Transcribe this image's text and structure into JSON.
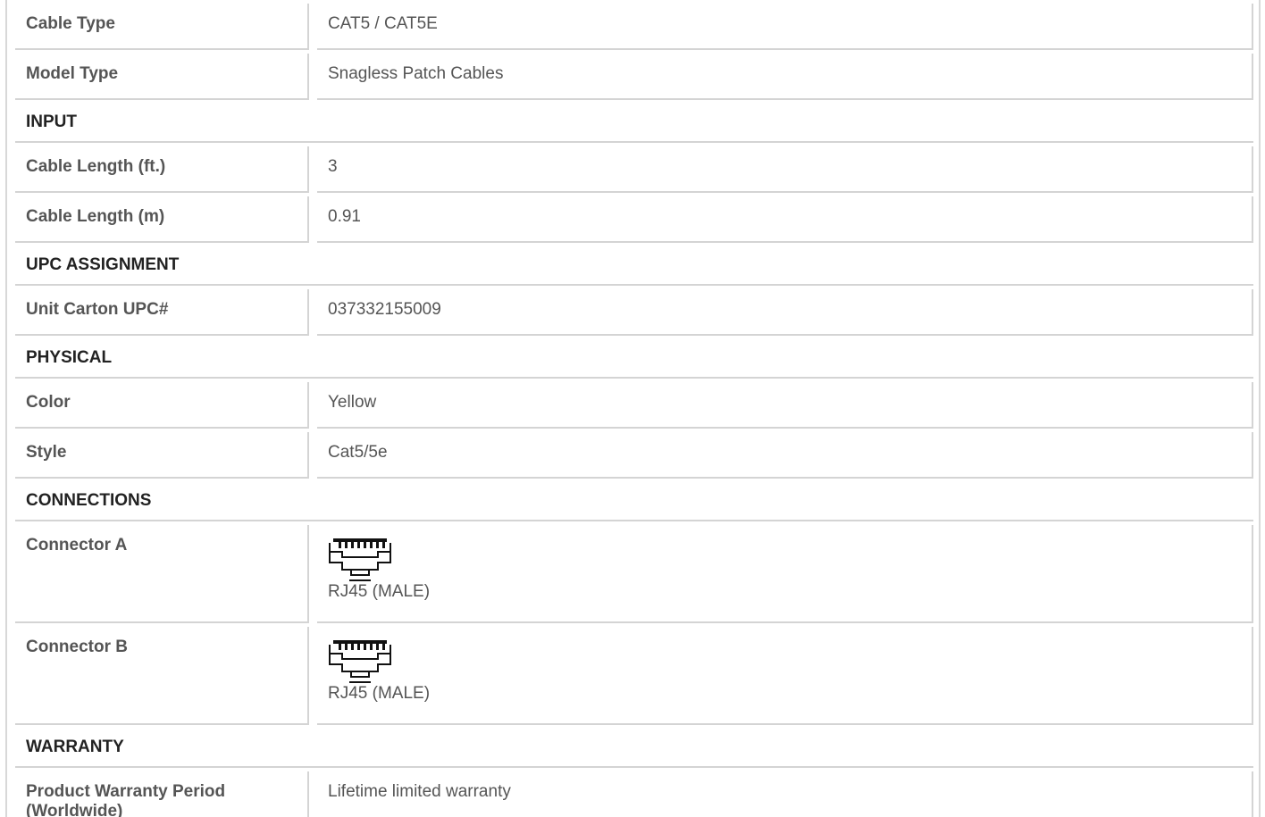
{
  "rows": {
    "cable_type": {
      "label": "Cable Type",
      "value": "CAT5 / CAT5E"
    },
    "model_type": {
      "label": "Model Type",
      "value": "Snagless Patch Cables"
    },
    "cable_length_ft": {
      "label": "Cable Length (ft.)",
      "value": "3"
    },
    "cable_length_m": {
      "label": "Cable Length (m)",
      "value": "0.91"
    },
    "unit_carton_upc": {
      "label": "Unit Carton UPC#",
      "value": "037332155009"
    },
    "color": {
      "label": "Color",
      "value": "Yellow"
    },
    "style": {
      "label": "Style",
      "value": "Cat5/5e"
    },
    "connector_a": {
      "label": "Connector A",
      "value": "RJ45 (MALE)",
      "icon": "rj45-connector-icon"
    },
    "connector_b": {
      "label": "Connector B",
      "value": "RJ45 (MALE)",
      "icon": "rj45-connector-icon"
    },
    "warranty_period": {
      "label": "Product Warranty Period (Worldwide)",
      "value": "Lifetime limited warranty"
    }
  },
  "sections": {
    "input": "INPUT",
    "upc_assignment": "UPC ASSIGNMENT",
    "physical": "PHYSICAL",
    "connections": "CONNECTIONS",
    "warranty": "WARRANTY"
  },
  "colors": {
    "label_text": "#555555",
    "section_text": "#222222",
    "border": "#d4d4d4"
  }
}
